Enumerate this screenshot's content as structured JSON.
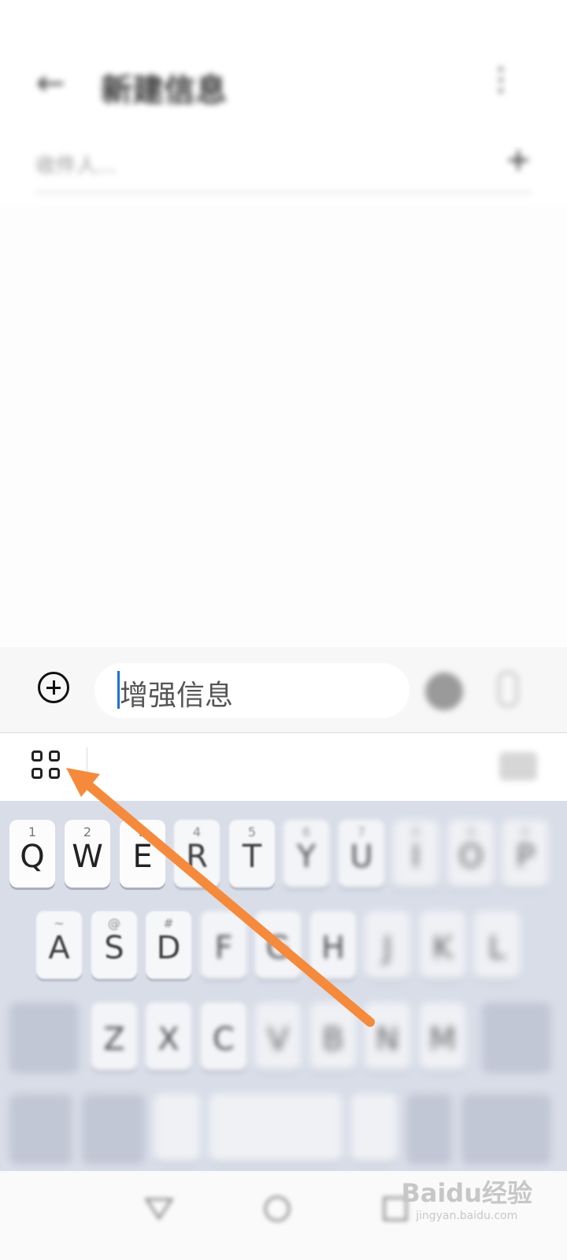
{
  "status_bar": {
    "left_text": "",
    "right_text": ""
  },
  "header": {
    "title": "新建信息"
  },
  "recipient": {
    "placeholder": "收件人..."
  },
  "composer": {
    "text": "增强信息"
  },
  "keyboard": {
    "row1": [
      {
        "key": "Q",
        "sup": "1"
      },
      {
        "key": "W",
        "sup": "2"
      },
      {
        "key": "E",
        "sup": "3"
      },
      {
        "key": "R",
        "sup": "4"
      },
      {
        "key": "T",
        "sup": "5"
      },
      {
        "key": "Y",
        "sup": "6"
      },
      {
        "key": "U",
        "sup": "7"
      },
      {
        "key": "I",
        "sup": "8"
      },
      {
        "key": "O",
        "sup": "9"
      },
      {
        "key": "P",
        "sup": "0"
      }
    ],
    "row2": [
      {
        "key": "A",
        "sup": "~"
      },
      {
        "key": "S",
        "sup": "@"
      },
      {
        "key": "D",
        "sup": "#"
      },
      {
        "key": "F",
        "sup": ""
      },
      {
        "key": "G",
        "sup": ""
      },
      {
        "key": "H",
        "sup": ""
      },
      {
        "key": "J",
        "sup": ""
      },
      {
        "key": "K",
        "sup": ""
      },
      {
        "key": "L",
        "sup": ""
      }
    ],
    "row3": [
      {
        "key": "Z",
        "sup": ""
      },
      {
        "key": "X",
        "sup": ""
      },
      {
        "key": "C",
        "sup": ""
      },
      {
        "key": "V",
        "sup": ""
      },
      {
        "key": "B",
        "sup": ""
      },
      {
        "key": "N",
        "sup": ""
      },
      {
        "key": "M",
        "sup": ""
      }
    ]
  },
  "watermark": {
    "brand": "Baidu经验",
    "url": "jingyan.baidu.com"
  },
  "annotation": {
    "arrow_color": "#f58a3c"
  },
  "colors": {
    "keyboard_bg": "#d8dde8",
    "caret": "#1f6fd1"
  }
}
